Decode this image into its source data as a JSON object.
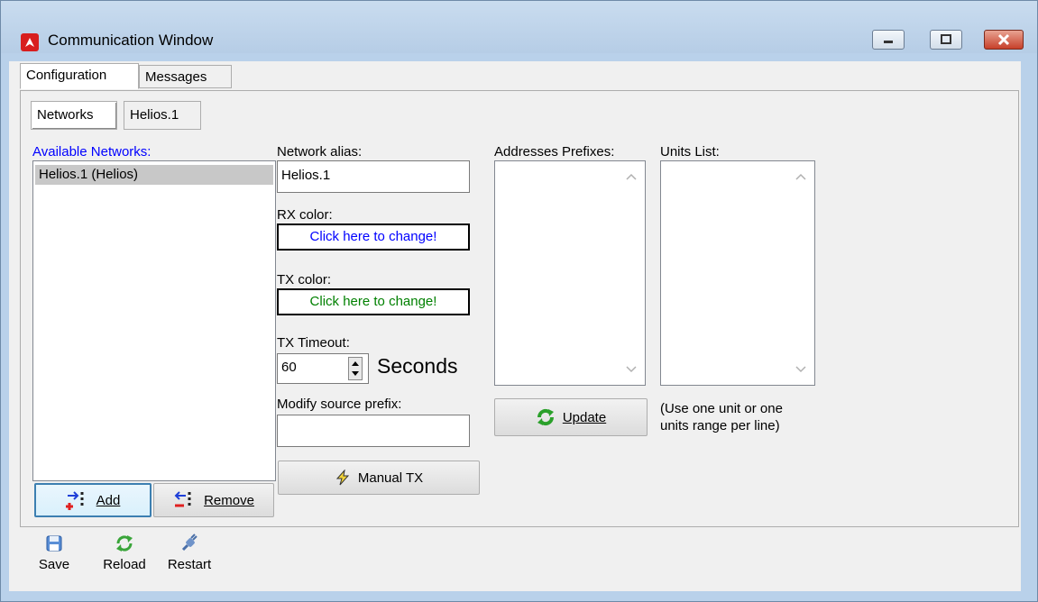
{
  "window": {
    "title": "Communication Window",
    "caption_buttons": [
      "minimize",
      "maximize",
      "close"
    ]
  },
  "main_tabs": [
    {
      "label": "Configuration",
      "active": true
    },
    {
      "label": "Messages",
      "active": false
    }
  ],
  "sub_tabs": [
    {
      "label": "Networks",
      "active": true
    },
    {
      "label": "Helios.1",
      "active": false
    }
  ],
  "networks": {
    "label": "Available Networks:",
    "items": [
      "Helios.1 (Helios)"
    ],
    "add_label": "Add",
    "remove_label": "Remove"
  },
  "form": {
    "alias_label": "Network alias:",
    "alias_value": "Helios.1",
    "rx_label": "RX color:",
    "rx_button": "Click here to change!",
    "rx_color": "#0000ff",
    "tx_label": "TX color:",
    "tx_button": "Click here to change!",
    "tx_color": "#008000",
    "timeout_label": "TX Timeout:",
    "timeout_value": "60",
    "timeout_unit": "Seconds",
    "source_prefix_label": "Modify source prefix:",
    "source_prefix_value": "",
    "manual_tx_label": "Manual TX"
  },
  "addresses": {
    "label": "Addresses Prefixes:",
    "update_label": "Update"
  },
  "units": {
    "label": "Units List:",
    "hint": "(Use one unit or one units range per line)",
    "hint_line1": "(Use one unit or one",
    "hint_line2": "units range per line)"
  },
  "toolbar": {
    "save_label": "Save",
    "reload_label": "Reload",
    "restart_label": "Restart"
  },
  "colors": {
    "title_bar": "#b9d1ea",
    "panel": "#f0f0f0",
    "selection": "#c8c8c8",
    "label_blue": "#0000ff"
  }
}
